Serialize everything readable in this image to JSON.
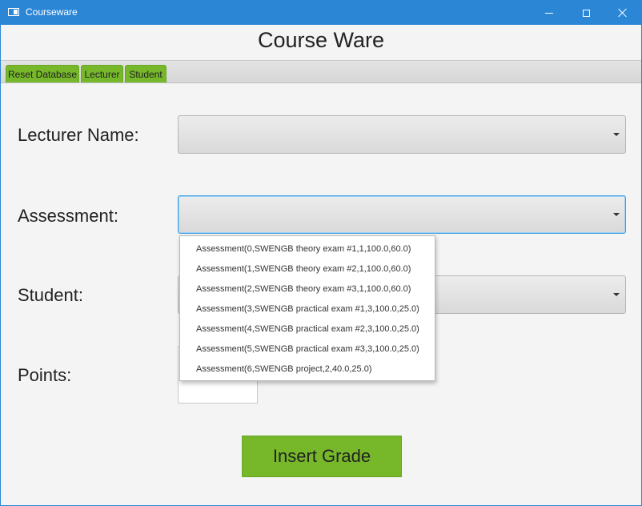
{
  "window": {
    "title": "Courseware"
  },
  "header": {
    "title": "Course Ware"
  },
  "tabs": [
    {
      "label": "Reset Database"
    },
    {
      "label": "Lecturer"
    },
    {
      "label": "Student"
    }
  ],
  "form": {
    "lecturer_label": "Lecturer Name:",
    "assessment_label": "Assessment:",
    "student_label": "Student:",
    "points_label": "Points:",
    "lecturer_value": "",
    "assessment_value": "",
    "student_value": "",
    "points_value": ""
  },
  "assessment_options": [
    "Assessment(0,SWENGB theory exam #1,1,100.0,60.0)",
    "Assessment(1,SWENGB theory exam #2,1,100.0,60.0)",
    "Assessment(2,SWENGB theory exam #3,1,100.0,60.0)",
    "Assessment(3,SWENGB practical exam #1,3,100.0,25.0)",
    "Assessment(4,SWENGB practical exam #2,3,100.0,25.0)",
    "Assessment(5,SWENGB practical exam #3,3,100.0,25.0)",
    "Assessment(6,SWENGB project,2,40.0,25.0)"
  ],
  "actions": {
    "insert_label": "Insert Grade"
  },
  "colors": {
    "titlebar": "#2b86d6",
    "accent_green": "#76b82a",
    "focus_blue": "#3c9fe3"
  }
}
